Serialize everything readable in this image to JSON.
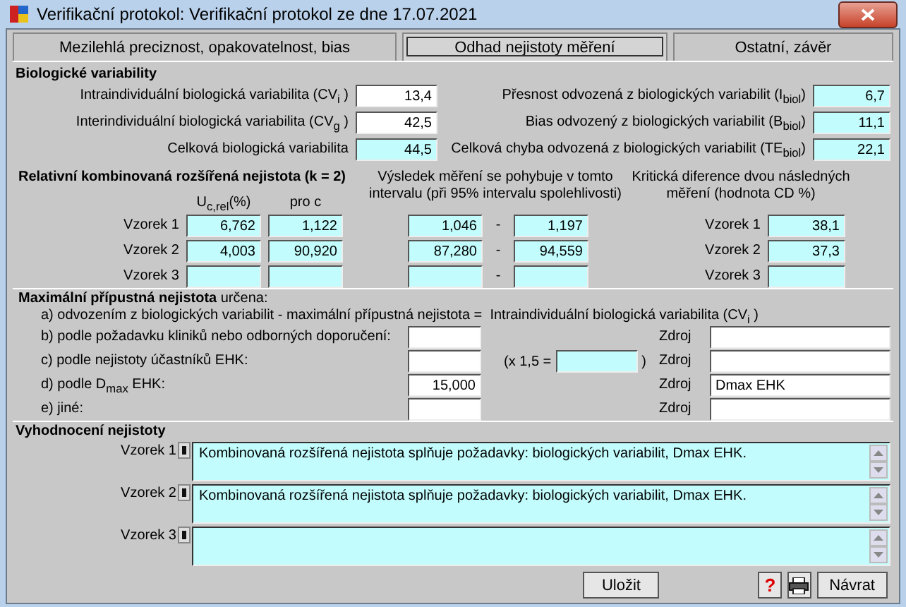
{
  "window": {
    "title": "Verifikační protokol: Verifikační protokol ze dne 17.07.2021"
  },
  "tabs": [
    {
      "label": "Mezilehlá preciznost, opakovatelnost, bias",
      "selected": false
    },
    {
      "label": "Odhad nejistoty měření",
      "selected": true
    },
    {
      "label": "Ostatní, závěr",
      "selected": false
    }
  ],
  "biological_variability": {
    "title": "Biologické variability",
    "left": [
      {
        "label": "Intraindividuální biologická variabilita (CV$_{i}$ )",
        "value": "13,4",
        "computed": false
      },
      {
        "label": "Interindividuální biologická variabilita (CV$_{g}$ )",
        "value": "42,5",
        "computed": false
      },
      {
        "label": "Celková biologická variabilita",
        "value": "44,5",
        "computed": true
      }
    ],
    "right": [
      {
        "label": "Přesnost odvozená z biologických variabilit (I$_{biol}$)",
        "value": "6,7",
        "computed": true
      },
      {
        "label": "Bias odvozený z biologických variabilit (B$_{biol}$)",
        "value": "11,1",
        "computed": true
      },
      {
        "label": "Celková chyba odvozená z biologických variabilit (TE$_{biol}$)",
        "value": "22,1",
        "computed": true
      }
    ]
  },
  "combined_uncertainty": {
    "title": "Relativní kombinovaná rozšířená nejistota (k = 2)",
    "result_header": "Výsledek měření se pohybuje v tomto intervalu (při 95% intervalu spolehlivosti)",
    "cd_header": "Kritická diference dvou následných měření (hodnota CD %)",
    "columns": [
      "U$_{c,rel}$(%)",
      "pro c"
    ],
    "rows": [
      {
        "label": "Vzorek 1",
        "u": "6,762",
        "c": "1,122",
        "low": "1,046",
        "separator": "-",
        "high": "1,197",
        "cd_label": "Vzorek 1",
        "cd": "38,1"
      },
      {
        "label": "Vzorek 2",
        "u": "4,003",
        "c": "90,920",
        "low": "87,280",
        "separator": "-",
        "high": "94,559",
        "cd_label": "Vzorek 2",
        "cd": "37,3"
      },
      {
        "label": "Vzorek 3",
        "separator": "-",
        "cd_label": "Vzorek 3"
      }
    ]
  },
  "max_uncertainty": {
    "intro": "**Maximální přípustná nejistota** určena:",
    "rows": [
      {
        "kind": "text",
        "label": "a) odvozením z biologických variabilit - maximální přípustná nejistota =",
        "value": "Intraindividuální biologická variabilita (CV$_{i}$ )"
      },
      {
        "kind": "field",
        "label": "b) podle požadavku kliniků nebo odborných doporučení:",
        "source_label": "Zdroj"
      },
      {
        "kind": "factor",
        "label": "c) podle nejistoty účastníků EHK:",
        "factor_prefix": "(x 1,5 =",
        "factor_suffix": ")",
        "source_label": "Zdroj"
      },
      {
        "kind": "field",
        "label": "d) podle D$_{max}$ EHK:",
        "value": "15,000",
        "source_label": "Zdroj",
        "source": "Dmax EHK"
      },
      {
        "kind": "field",
        "label": "e) jiné:",
        "source_label": "Zdroj"
      }
    ]
  },
  "evaluation": {
    "title": "Vyhodnocení nejistoty",
    "rows": [
      {
        "label": "Vzorek 1",
        "text": "Kombinovaná rozšířená nejistota splňuje požadavky: biologických variabilit, Dmax EHK."
      },
      {
        "label": "Vzorek 2",
        "text": "Kombinovaná rozšířená nejistota splňuje požadavky: biologických variabilit, Dmax EHK."
      },
      {
        "label": "Vzorek 3"
      }
    ]
  },
  "buttons": [
    {
      "kind": "text",
      "label": "Uložit"
    },
    {
      "kind": "help",
      "label": "?"
    },
    {
      "kind": "print"
    },
    {
      "kind": "text",
      "label": "Návrat"
    }
  ]
}
